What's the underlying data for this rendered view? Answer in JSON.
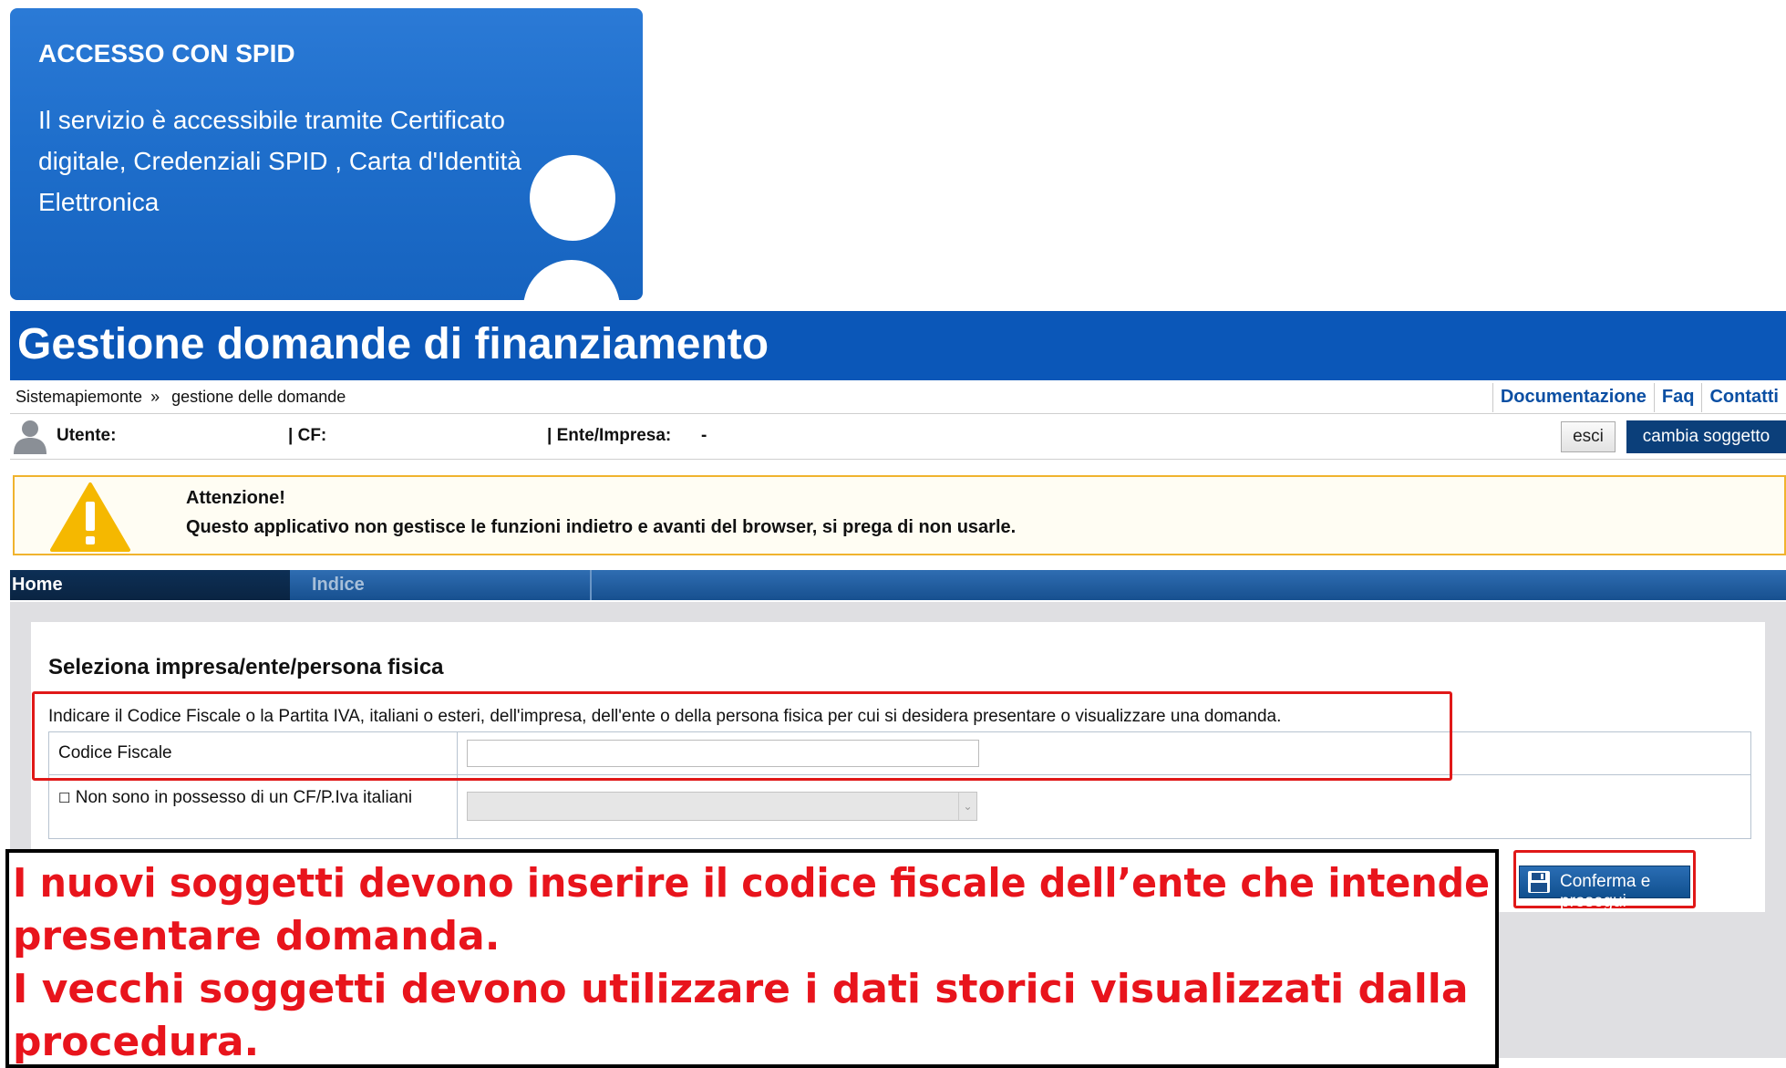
{
  "spid": {
    "title": "ACCESSO CON SPID",
    "text": "Il servizio è accessibile tramite Certificato digitale, Credenziali SPID , Carta d'Identità Elettronica"
  },
  "header": {
    "title": "Gestione domande di finanziamento"
  },
  "breadcrumb": {
    "root": "Sistemapiemonte",
    "separator": "»",
    "current": "gestione delle domande"
  },
  "toplinks": [
    "Documentazione",
    "Faq",
    "Contatti"
  ],
  "user": {
    "utente_label": "Utente:",
    "cf_label": "| CF:",
    "ente_label": "| Ente/Impresa:",
    "ente_value": "-",
    "esci": "esci",
    "cambia": "cambia soggetto"
  },
  "warning": {
    "title": "Attenzione!",
    "text": "Questo applicativo non gestisce le funzioni indietro e avanti del browser, si prega di non usarle."
  },
  "nav": {
    "home": "Home",
    "indice": "Indice"
  },
  "form": {
    "title": "Seleziona impresa/ente/persona fisica",
    "instructions": "Indicare il Codice Fiscale o la Partita IVA, italiani o esteri, dell'impresa, dell'ente o della persona fisica per cui si desidera presentare o visualizzare una domanda.",
    "cf_label": "Codice Fiscale",
    "cf_value": "",
    "no_cf_label": "Non sono in possesso di un CF/P.Iva italiani",
    "confirm_button": "Conferma e prosegui"
  },
  "annotation": {
    "line1": "I nuovi soggetti devono inserire il codice fiscale dell’ente che intende",
    "line2": "presentare domanda.",
    "line3": "I vecchi soggetti devono utilizzare i dati storici visualizzati dalla",
    "line4": "procedura."
  },
  "colors": {
    "header_blue": "#0b57b8",
    "warning_border": "#f0b32e",
    "annotation_red": "#e8141c"
  }
}
